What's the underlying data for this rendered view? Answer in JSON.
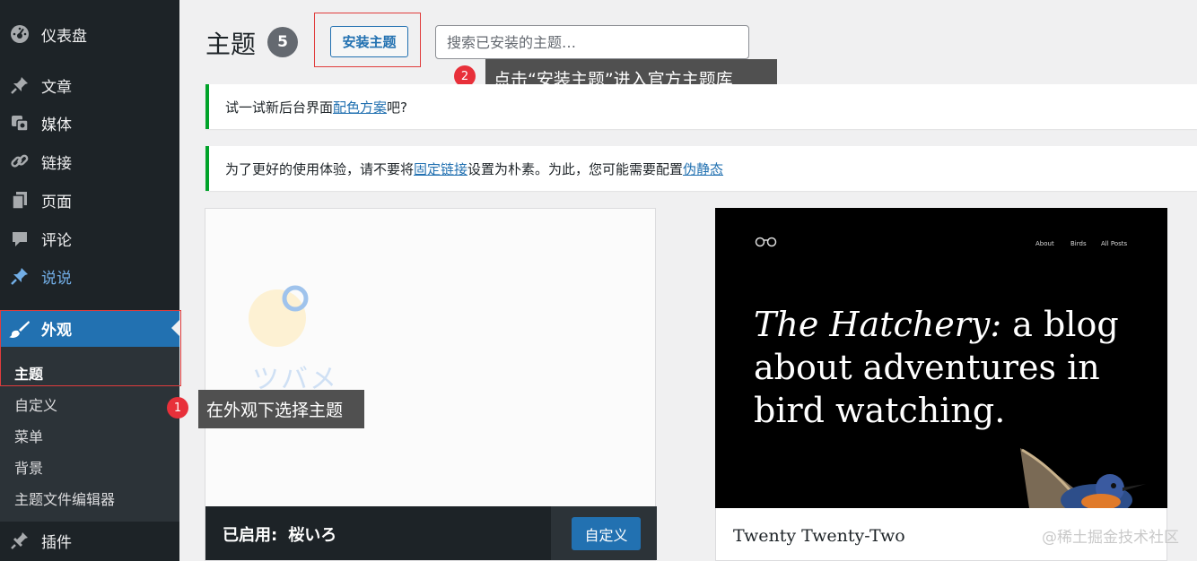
{
  "sidebar": {
    "items": [
      {
        "label": "仪表盘",
        "icon": "dashboard-icon"
      },
      {
        "label": "文章",
        "icon": "pin-icon"
      },
      {
        "label": "媒体",
        "icon": "media-icon"
      },
      {
        "label": "链接",
        "icon": "link-icon"
      },
      {
        "label": "页面",
        "icon": "page-icon"
      },
      {
        "label": "评论",
        "icon": "comment-icon"
      },
      {
        "label": "说说",
        "icon": "pin-icon"
      },
      {
        "label": "外观",
        "icon": "brush-icon"
      },
      {
        "label": "插件",
        "icon": "plugin-icon"
      }
    ],
    "submenu": [
      "主题",
      "自定义",
      "菜单",
      "背景",
      "主题文件编辑器"
    ]
  },
  "header": {
    "title": "主题",
    "count": "5",
    "install_label": "安装主题",
    "search_placeholder": "搜索已安装的主题…"
  },
  "notices": {
    "n1_prefix": "试一试新后台界面",
    "n1_link": "配色方案",
    "n1_suffix": "吧?",
    "n2_prefix": "为了更好的使用体验，请不要将",
    "n2_link1": "固定链接",
    "n2_mid": "设置为朴素。为此，您可能需要配置",
    "n2_link2": "伪静态"
  },
  "annotations": {
    "step1_num": "1",
    "step1_text": "在外观下选择主题",
    "step2_num": "2",
    "step2_text": "点击“安装主题”进入官方主题库"
  },
  "themes": {
    "card1": {
      "active_prefix": "已启用:",
      "name": "桜いろ",
      "customize_label": "自定义",
      "logo_text": "ツバメ"
    },
    "card2": {
      "name": "Twenty Twenty-Two",
      "screenshot_nav": [
        "About",
        "Birds",
        "All Posts"
      ],
      "screenshot_heading_italic": "The Hatchery:",
      "screenshot_heading_rest": "a blog about adventures in bird watching."
    }
  },
  "watermark": "@稀土掘金技术社区",
  "colors": {
    "sidebar_bg": "#1d2327",
    "accent": "#2271b1",
    "notice_border": "#00a32a",
    "annotation_red": "#e8303a"
  }
}
